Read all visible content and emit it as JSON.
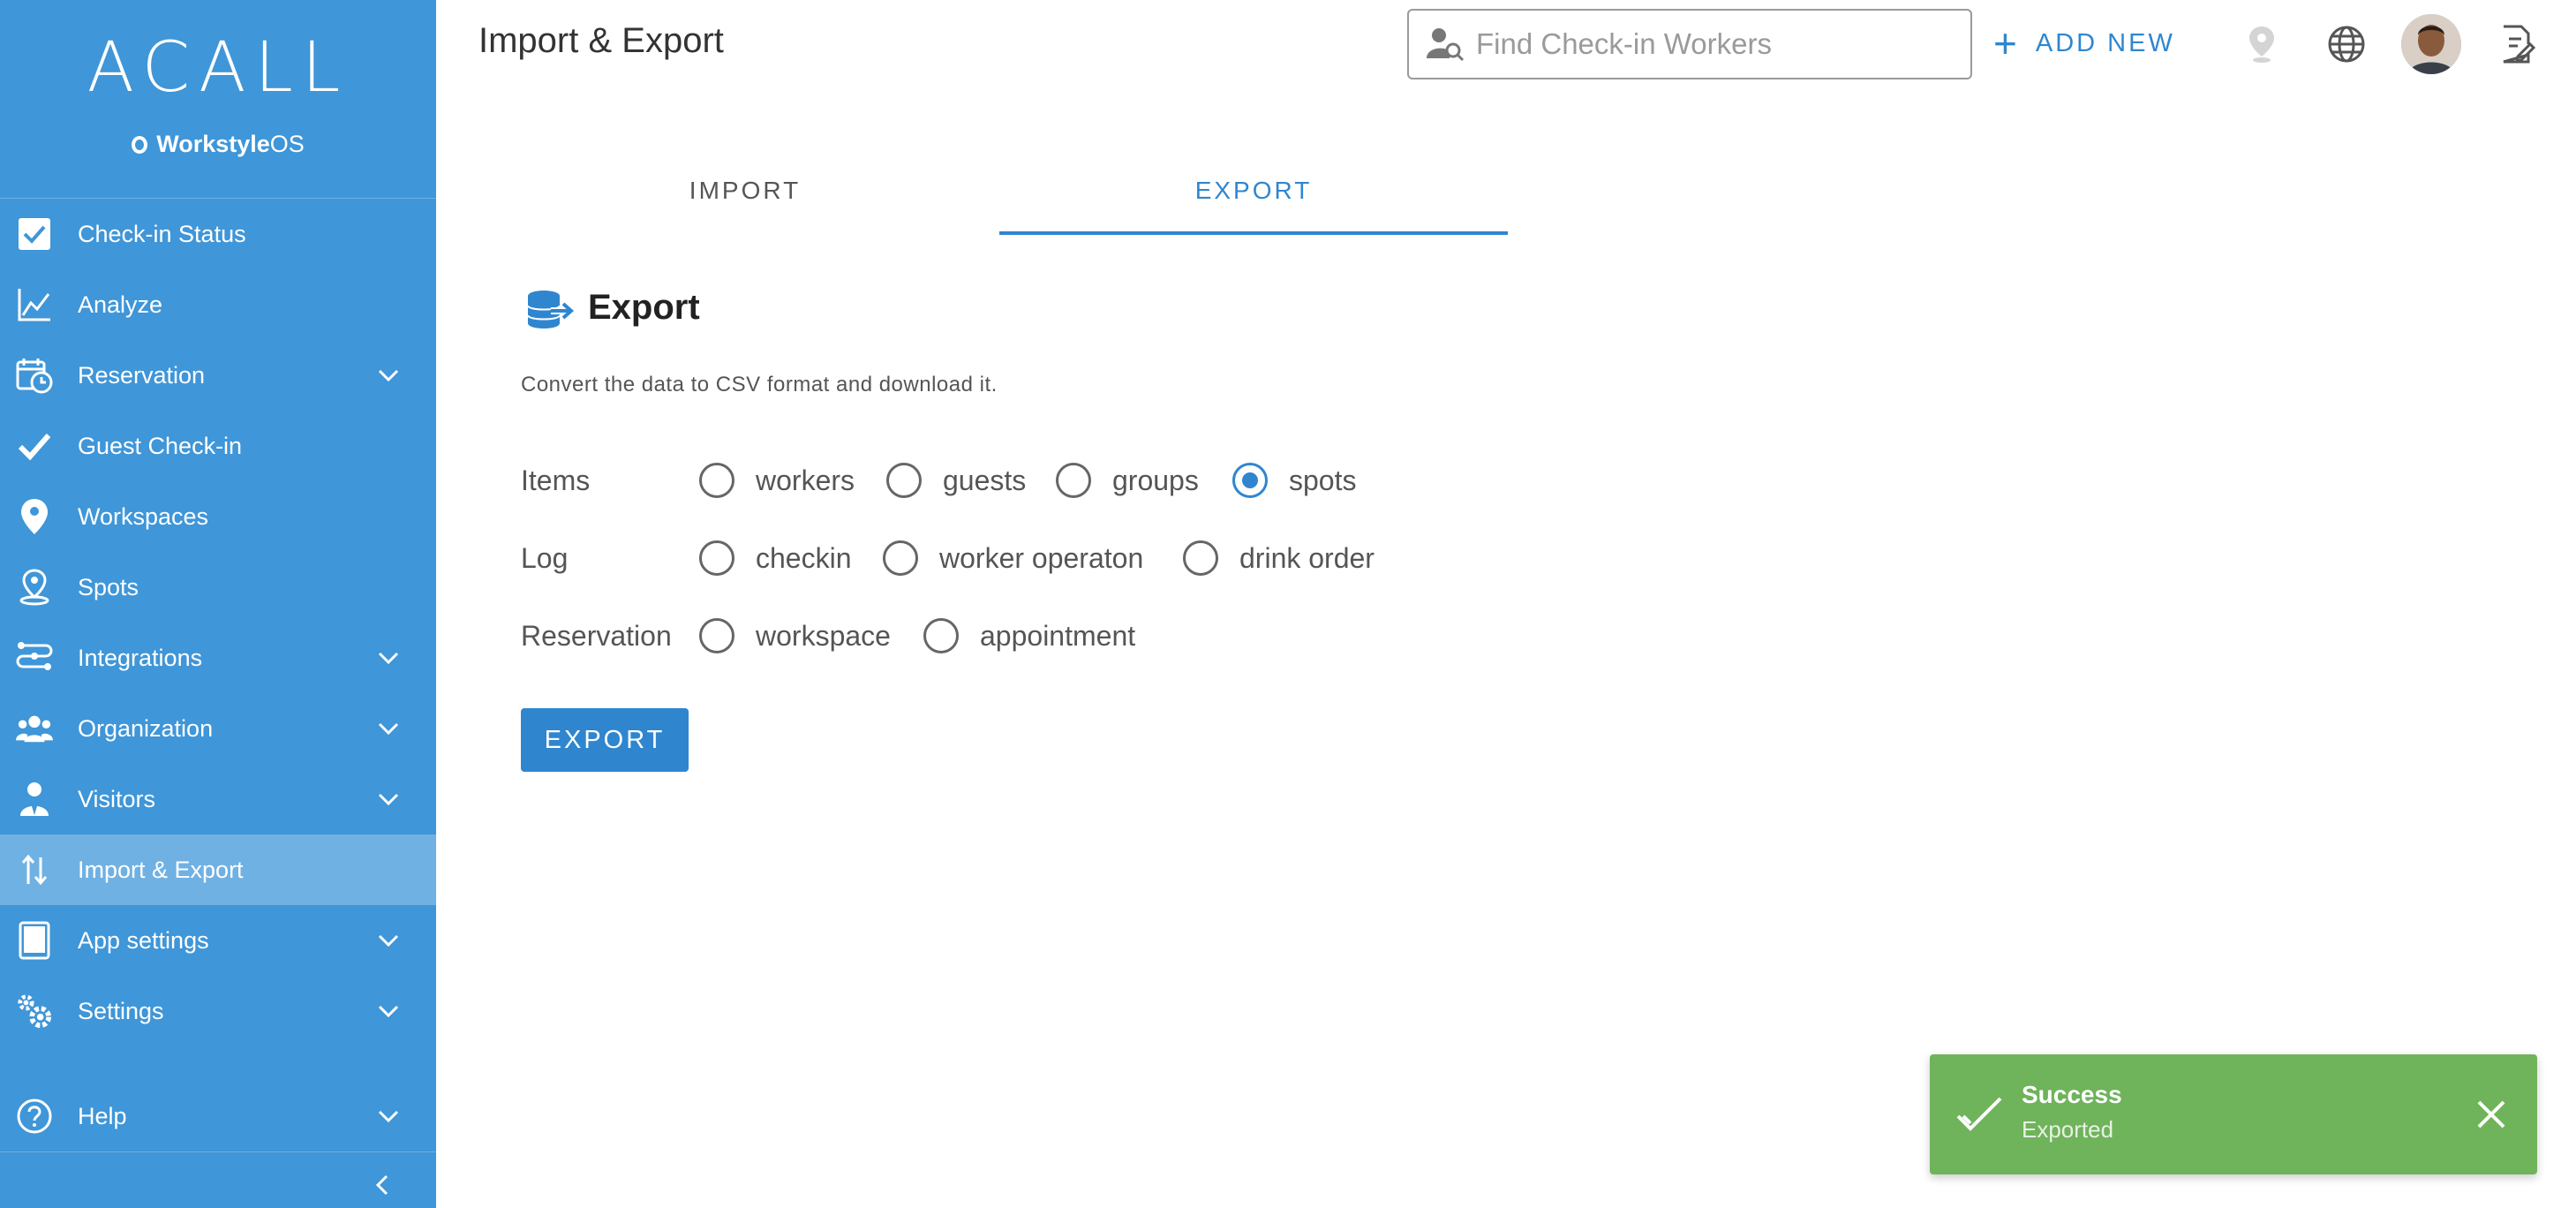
{
  "app": {
    "logo": "ACALL",
    "brand_bold": "Workstyle",
    "brand_light": "OS"
  },
  "header": {
    "title": "Import & Export",
    "search_placeholder": "Find Check-in Workers",
    "add_new": "ADD NEW"
  },
  "sidebar": {
    "items": [
      {
        "label": "Check-in Status",
        "icon": "checkbox-icon",
        "expandable": false
      },
      {
        "label": "Analyze",
        "icon": "line-chart-icon",
        "expandable": false
      },
      {
        "label": "Reservation",
        "icon": "calendar-clock-icon",
        "expandable": true
      },
      {
        "label": "Guest Check-in",
        "icon": "checkmark-icon",
        "expandable": false
      },
      {
        "label": "Workspaces",
        "icon": "map-pin-icon",
        "expandable": false
      },
      {
        "label": "Spots",
        "icon": "spot-pin-icon",
        "expandable": false
      },
      {
        "label": "Integrations",
        "icon": "integrations-icon",
        "expandable": true
      },
      {
        "label": "Organization",
        "icon": "people-icon",
        "expandable": true
      },
      {
        "label": "Visitors",
        "icon": "visitor-icon",
        "expandable": true
      },
      {
        "label": "Import & Export",
        "icon": "import-export-icon",
        "expandable": false,
        "active": true
      },
      {
        "label": "App settings",
        "icon": "tablet-icon",
        "expandable": true
      },
      {
        "label": "Settings",
        "icon": "gears-icon",
        "expandable": true
      }
    ],
    "help": {
      "label": "Help",
      "icon": "help-icon",
      "expandable": true
    }
  },
  "tabs": {
    "import": "IMPORT",
    "export": "EXPORT",
    "active": "export"
  },
  "export_section": {
    "title": "Export",
    "description": "Convert the data to CSV format and download it.",
    "rows": [
      {
        "label": "Items",
        "options": [
          "workers",
          "guests",
          "groups",
          "spots"
        ],
        "selected": "spots"
      },
      {
        "label": "Log",
        "options": [
          "checkin",
          "worker operaton",
          "drink order"
        ],
        "selected": null
      },
      {
        "label": "Reservation",
        "options": [
          "workspace",
          "appointment"
        ],
        "selected": null
      }
    ],
    "button": "EXPORT"
  },
  "toast": {
    "title": "Success",
    "message": "Exported",
    "color": "#6fb35b"
  },
  "colors": {
    "sidebar": "#3f96d8",
    "sidebar_active": "#70b1e3",
    "accent": "#2f86cf"
  }
}
